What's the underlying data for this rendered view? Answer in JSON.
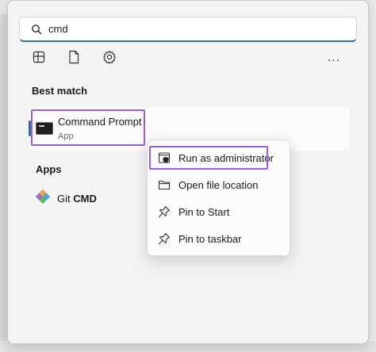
{
  "search": {
    "value": "cmd",
    "icon": "search-icon"
  },
  "filters": {
    "apps_icon": "apps-grid-icon",
    "documents_icon": "document-icon",
    "settings_icon": "gear-icon",
    "more_label": "..."
  },
  "best_match": {
    "title": "Best match",
    "app_name": "Command Prompt",
    "app_type": "App",
    "icon": "command-prompt-icon"
  },
  "apps": {
    "title": "Apps",
    "items": [
      {
        "prefix": "Git ",
        "bold": "CMD",
        "icon": "git-cmd-icon"
      }
    ]
  },
  "context_menu": {
    "items": [
      {
        "label": "Run as administrator",
        "icon": "shield-admin-icon"
      },
      {
        "label": "Open file location",
        "icon": "folder-icon"
      },
      {
        "label": "Pin to Start",
        "icon": "pin-icon"
      },
      {
        "label": "Pin to taskbar",
        "icon": "pin-icon"
      }
    ]
  },
  "colors": {
    "accent": "#2a6fb5",
    "highlight": "#a25bd6",
    "panel": "#f3f3f3"
  }
}
